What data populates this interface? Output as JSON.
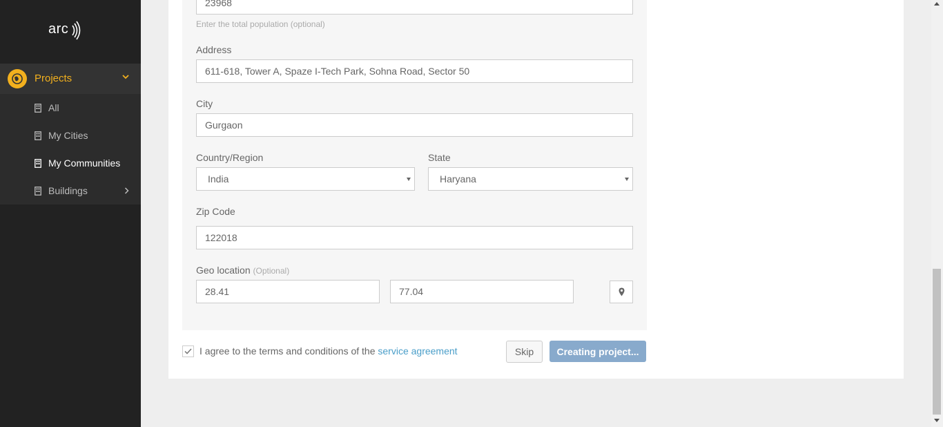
{
  "sidebar": {
    "logo_text": "arc",
    "projects_label": "Projects",
    "items": [
      {
        "label": "All"
      },
      {
        "label": "My Cities"
      },
      {
        "label": "My Communities"
      },
      {
        "label": "Buildings"
      }
    ]
  },
  "form": {
    "population_value": "23968",
    "population_hint": "Enter the total population (optional)",
    "address_label": "Address",
    "address_value": "611-618, Tower A, Spaze I-Tech Park, Sohna Road, Sector 50",
    "city_label": "City",
    "city_value": "Gurgaon",
    "country_label": "Country/Region",
    "country_value": "India",
    "state_label": "State",
    "state_value": "Haryana",
    "zip_label": "Zip Code",
    "zip_value": "122018",
    "geo_label": "Geo location",
    "geo_optional": "(Optional)",
    "latitude_value": "28.41",
    "longitude_value": "77.04"
  },
  "footer": {
    "agree_text": "I agree to the terms and conditions of the",
    "agree_link": "service agreement",
    "skip_label": "Skip",
    "create_label": "Creating project..."
  },
  "colors": {
    "sidebar_bg": "#222222",
    "accent": "#f2b01e",
    "link": "#4a9ec9",
    "button_disabled": "#88aacc"
  }
}
